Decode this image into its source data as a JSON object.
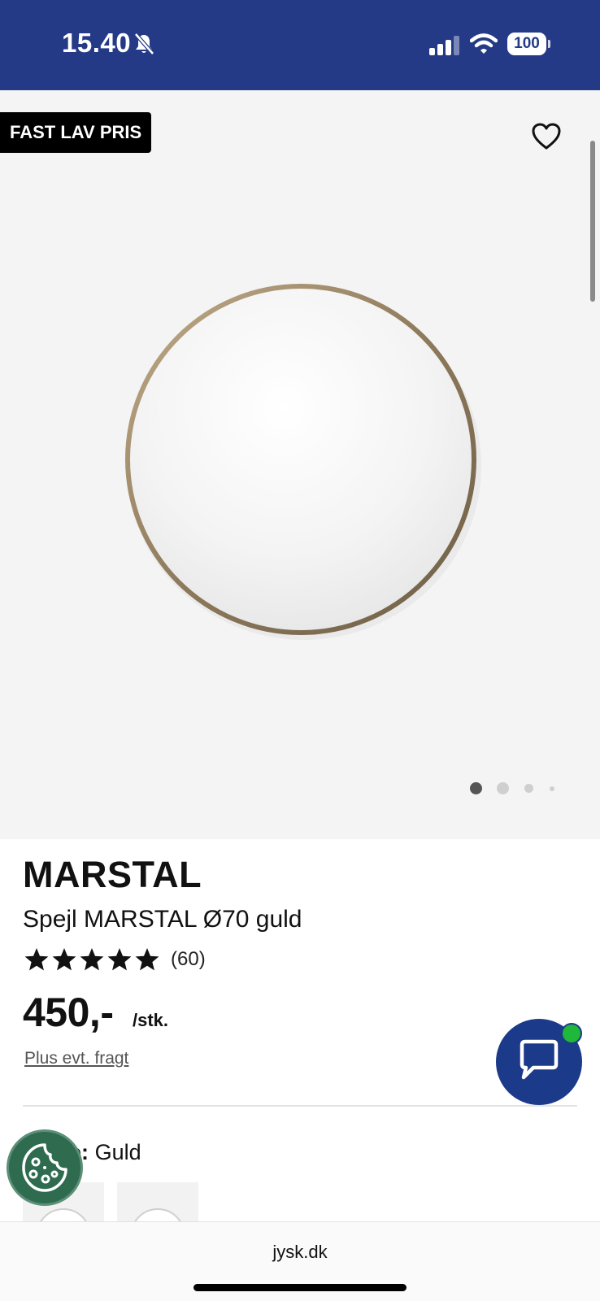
{
  "status_bar": {
    "time": "15.40",
    "battery": "100",
    "bell_icon": "bell-slash-icon",
    "signal_icon": "cellular-signal-icon",
    "wifi_icon": "wifi-icon",
    "background_color": "#243a86"
  },
  "gallery": {
    "badge_label": "FAST LAV PRIS",
    "favorite_icon": "heart-outline-icon",
    "image_icon": "round-mirror-gold-frame",
    "page_count": 4,
    "active_page": 1
  },
  "product": {
    "brand": "MARSTAL",
    "name": "Spejl MARSTAL Ø70 guld",
    "rating": 5,
    "review_count": "(60)",
    "price": "450,-",
    "unit": "/stk.",
    "shipping_link": "Plus evt. fragt",
    "color_label": "Farve:",
    "color_value": "Guld"
  },
  "floating": {
    "chat_icon": "chat-bubble-icon",
    "chat_color": "#1c3a8a",
    "notification_color": "#1fb83a",
    "cookie_icon": "cookie-icon",
    "cookie_color": "#2e6b4f"
  },
  "browser": {
    "url": "jysk.dk"
  }
}
